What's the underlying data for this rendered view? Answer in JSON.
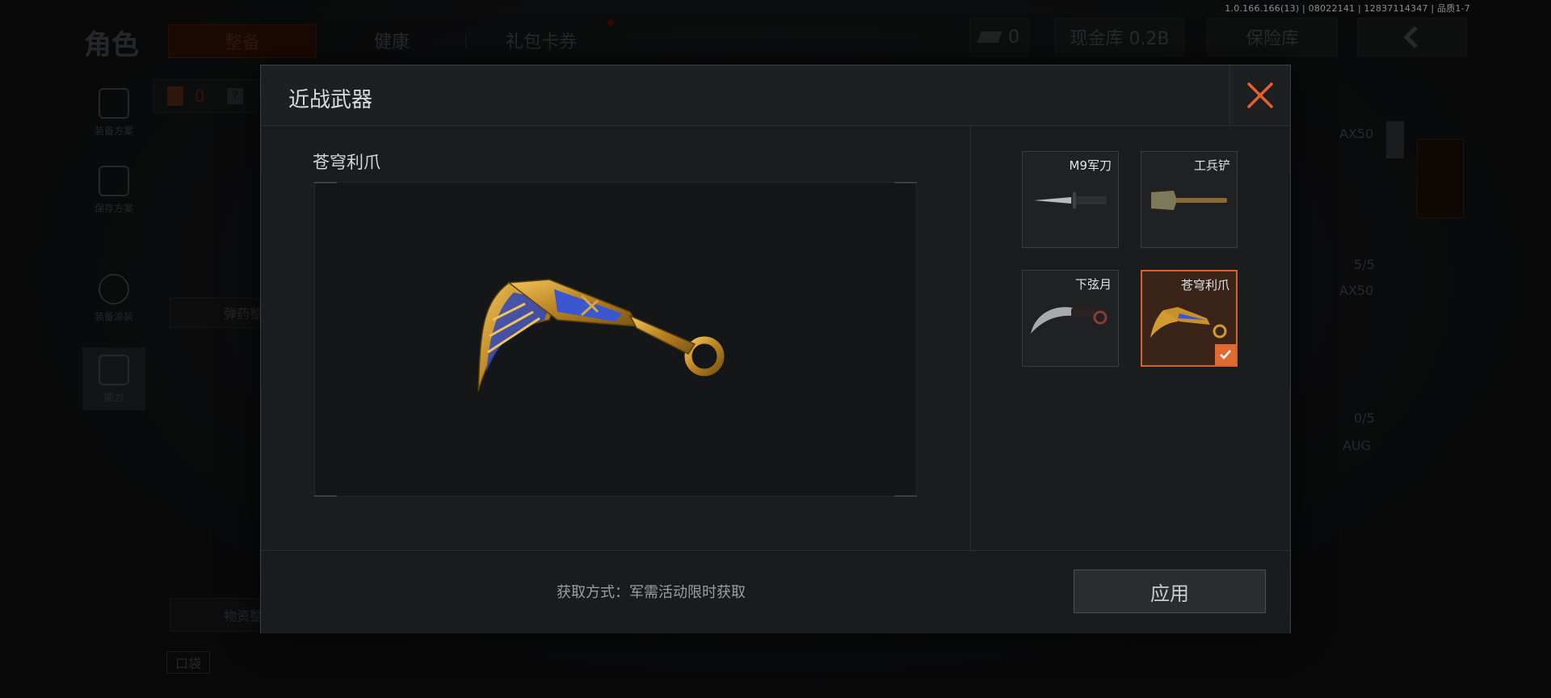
{
  "version_text": "1.0.166.166(13) | 08022141 | 12837114347 | 品质1-7",
  "page_title": "角色",
  "tabs": [
    {
      "label": "整备",
      "active": true
    },
    {
      "label": "健康",
      "active": false
    },
    {
      "label": "礼包卡券",
      "active": false
    }
  ],
  "header": {
    "currency_value": "0",
    "cash_vault": "现金库 0.2B",
    "safe_box": "保险库"
  },
  "sidebar": [
    {
      "label": "装备方案",
      "icon": "vest-icon"
    },
    {
      "label": "保存方案",
      "icon": "download-icon"
    },
    {
      "label": "装备涂装",
      "icon": "helmet-icon"
    },
    {
      "label": "能力",
      "icon": "lightning-hex-icon"
    }
  ],
  "background_panel": {
    "count": "0",
    "ammo_button": "弹药整备",
    "supply_button": "物资整备",
    "pocket_label": "口袋"
  },
  "right_column": {
    "slot1_name": "AX50",
    "slot1_count": "5/5",
    "slot2_name": "AX50",
    "slot2_count": "0/5",
    "slot3_name": "AUG"
  },
  "modal": {
    "title": "近战武器",
    "selected_item_name": "苍穹利爪",
    "acquire_text": "获取方式：军需活动限时获取",
    "apply_label": "应用",
    "items": [
      {
        "label": "M9军刀",
        "icon": "bayonet-icon",
        "selected": false
      },
      {
        "label": "工兵铲",
        "icon": "shovel-icon",
        "selected": false
      },
      {
        "label": "下弦月",
        "icon": "karambit-icon",
        "selected": false
      },
      {
        "label": "苍穹利爪",
        "icon": "karambit-gold-icon",
        "selected": true
      }
    ]
  },
  "colors": {
    "accent": "#e06a30",
    "modal_bg": "#1b1c1e",
    "preview_bg": "#151617"
  }
}
